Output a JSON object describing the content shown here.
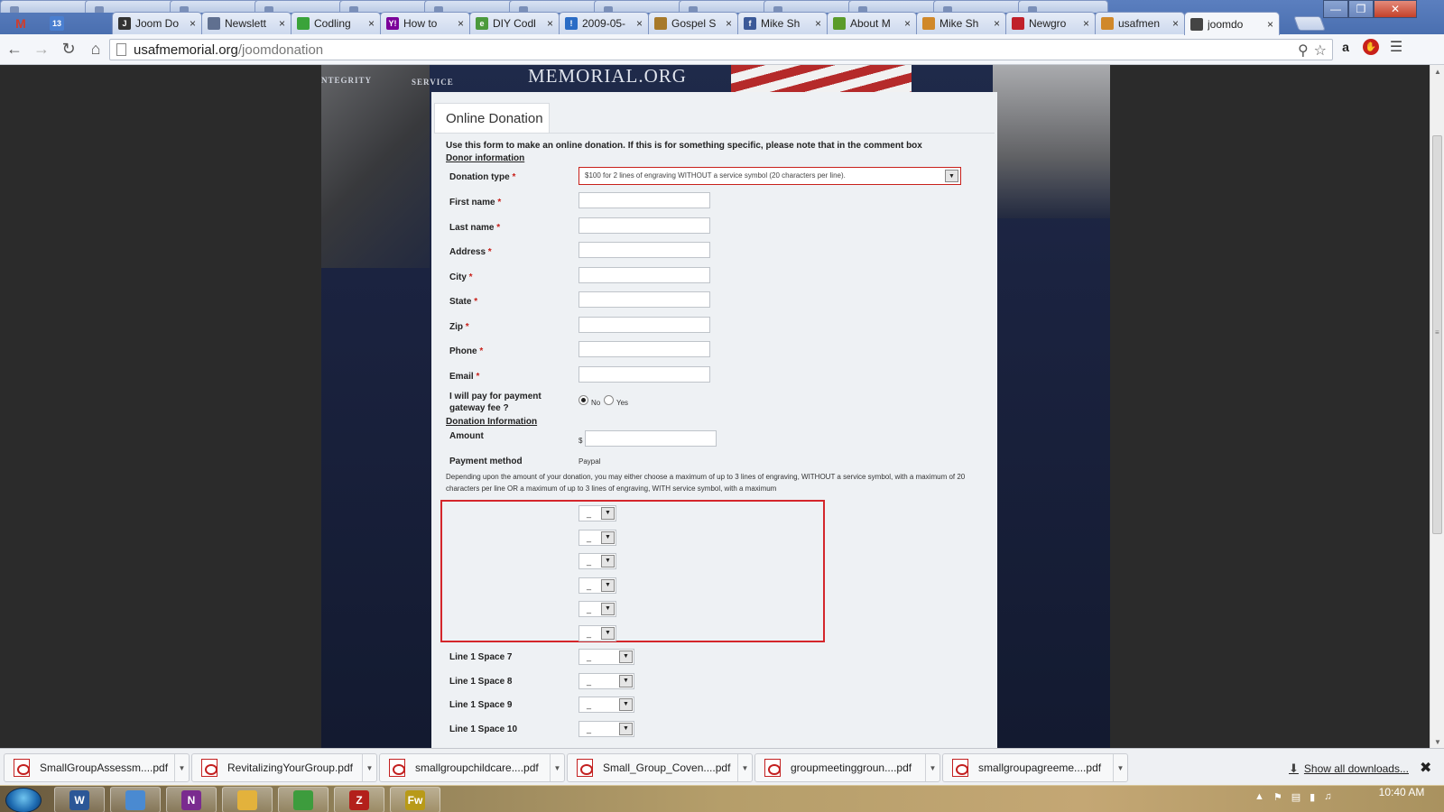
{
  "tabs": [
    {
      "label": "Joom Do",
      "fav_color": "#333333",
      "fav_glyph": "J"
    },
    {
      "label": "Newslett",
      "fav_color": "#607090",
      "fav_glyph": ""
    },
    {
      "label": "Codling",
      "fav_color": "#3aa33a",
      "fav_glyph": ""
    },
    {
      "label": "How to",
      "fav_color": "#7b0099",
      "fav_glyph": "Y!"
    },
    {
      "label": "DIY Codl",
      "fav_color": "#4c9a3c",
      "fav_glyph": "e"
    },
    {
      "label": "2009-05-",
      "fav_color": "#2a6cc5",
      "fav_glyph": "!"
    },
    {
      "label": "Gospel S",
      "fav_color": "#a7792a",
      "fav_glyph": ""
    },
    {
      "label": "Mike Sh",
      "fav_color": "#3b5998",
      "fav_glyph": "f"
    },
    {
      "label": "About M",
      "fav_color": "#5a9b2a",
      "fav_glyph": ""
    },
    {
      "label": "Mike Sh",
      "fav_color": "#d0882a",
      "fav_glyph": ""
    },
    {
      "label": "Newgro",
      "fav_color": "#c0202a",
      "fav_glyph": ""
    },
    {
      "label": "usafmen",
      "fav_color": "#d0882a",
      "fav_glyph": ""
    },
    {
      "label": "joomdo",
      "fav_color": "#444444",
      "fav_glyph": ""
    }
  ],
  "toolbar": {
    "url_host": "usafmemorial.org",
    "url_path": "/joomdonation"
  },
  "banner": {
    "logo_text": "MEMORIAL.ORG",
    "integrity": "NTEGRITY",
    "service": "SERVICE"
  },
  "form": {
    "heading": "Online Donation",
    "intro": "Use this form to make an online donation. If this is for something specific, please note that in the comment box",
    "donor_section": "Donor information",
    "donation_type_label": "Donation type",
    "donation_type_value": "$100 for 2 lines of engraving WITHOUT a service symbol (20 characters per line).",
    "fields": [
      {
        "label": "First name",
        "value": ""
      },
      {
        "label": "Last name",
        "value": ""
      },
      {
        "label": "Address",
        "value": ""
      },
      {
        "label": "City",
        "value": ""
      },
      {
        "label": "State",
        "value": ""
      },
      {
        "label": "Zip",
        "value": ""
      },
      {
        "label": "Phone",
        "value": ""
      },
      {
        "label": "Email",
        "value": ""
      }
    ],
    "gateway_fee_label": "I will pay for payment gateway fee ?",
    "gateway_no": "No",
    "gateway_yes": "Yes",
    "donation_section": "Donation Information",
    "amount_label": "Amount",
    "currency": "$",
    "amount_value": "",
    "payment_method_label": "Payment method",
    "payment_method_value": "Paypal",
    "engraving_note": "Depending upon the amount of your donation, you may either choose a maximum of up to 3 lines of engraving, WITHOUT a service symbol, with a maximum of 20 characters per line OR a maximum of up to 3 lines of engraving, WITH service symbol, with a maximum",
    "unlabeled_selects": [
      "_",
      "_",
      "_",
      "_",
      "_",
      "_"
    ],
    "line_selects": [
      {
        "label": "Line 1 Space 7",
        "value": "_"
      },
      {
        "label": "Line 1 Space 8",
        "value": "_"
      },
      {
        "label": "Line 1 Space 9",
        "value": "_"
      },
      {
        "label": "Line 1 Space 10",
        "value": "_"
      }
    ]
  },
  "downloads": {
    "items": [
      "SmallGroupAssessm....pdf",
      "RevitalizingYourGroup.pdf",
      "smallgroupchildcare....pdf",
      "Small_Group_Coven....pdf",
      "groupmeetinggroun....pdf",
      "smallgroupagreeme....pdf"
    ],
    "show_all": "Show all downloads..."
  },
  "taskbar": {
    "apps": [
      {
        "glyph": "W",
        "color": "#2b5797"
      },
      {
        "glyph": "",
        "color": "#4a8ad1"
      },
      {
        "glyph": "N",
        "color": "#7a2b8f"
      },
      {
        "glyph": "",
        "color": "#e3b23c"
      },
      {
        "glyph": "",
        "color": "#3d9c3d"
      },
      {
        "glyph": "Z",
        "color": "#b3201b"
      },
      {
        "glyph": "Fw",
        "color": "#b89a18"
      }
    ],
    "time": "10:40 AM"
  }
}
